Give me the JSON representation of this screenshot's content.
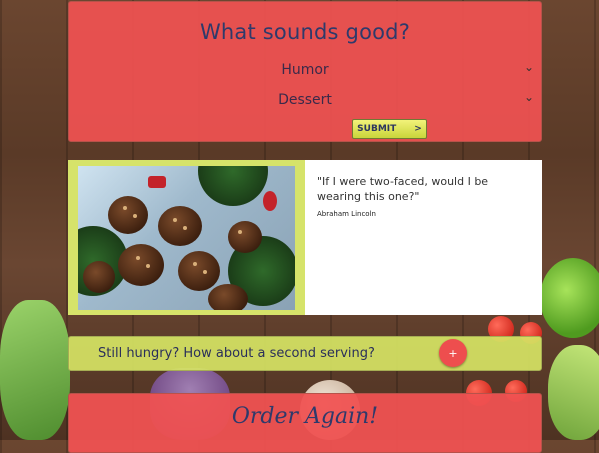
{
  "form": {
    "title": "What sounds good?",
    "select_1": "Humor",
    "select_2": "Dessert",
    "submit_label": "SUBMIT",
    "submit_arrow": ">"
  },
  "quote": {
    "text": "\"If I were two-faced, would I be wearing this one?\"",
    "author": "Abraham Lincoln"
  },
  "more": {
    "text": "Still hungry? How about a second serving?",
    "plus": "+"
  },
  "order": {
    "title": "Order Again!"
  },
  "colors": {
    "panel_red": "#f05252",
    "panel_yellow": "#d6e464",
    "title_blue": "#2e3a6b"
  }
}
